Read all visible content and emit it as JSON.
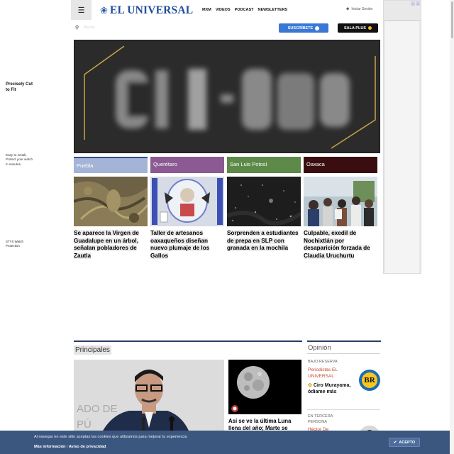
{
  "header": {
    "logo_text": "EL UNIVERSAL",
    "nav": [
      "MXM",
      "VIDEOS",
      "PODCAST",
      "NEWSLETTERS"
    ],
    "login_label": "Iniciar Sesión",
    "search_placeholder": "Buscar",
    "subscribe_label": "SUSCRÍBETE",
    "sala_plus_label": "SALA PLUS"
  },
  "ad": {
    "title": "Precisely Cut to Fit",
    "body": "Easy to install, Protect your watch in minutes.",
    "brand": "STYX Watch Protection"
  },
  "regions": [
    {
      "label": "Puebla",
      "color": "#a4b4d6",
      "title": "Se aparece la Virgen de Guadalupe en un árbol, señalan pobladores de Zautla"
    },
    {
      "label": "Querétaro",
      "color": "#8c5a93",
      "title": "Taller de artesanos oaxaqueños diseñan nuevo plumaje de los Gallos"
    },
    {
      "label": "San Luis Potosí",
      "color": "#5d8a48",
      "title": "Sorprenden a estudiantes de prepa en SLP con granada en la mochila"
    },
    {
      "label": "Oaxaca",
      "color": "#3a0e10",
      "title": "Culpable, exedil de Nochixtlán por desaparición forzada de Claudia Uruchurtu"
    }
  ],
  "principales": {
    "label": "Principales",
    "secondary_title": "Así se ve la última Luna llena del año; Marte se"
  },
  "opinion": {
    "label": "Opinión",
    "items": [
      {
        "section": "BAJO RESERVA",
        "author": "Periodistas EL UNIVERSAL",
        "headline": "Ciro Murayama, ódiame más",
        "logo_text": "BR"
      },
      {
        "section": "EN TERCERA PERSONA",
        "author": "Héctor De"
      }
    ]
  },
  "cookies": {
    "text": "Al navegar en este sitio aceptas las cookies que utilizamos para mejorar tu experiencia",
    "more_info": "Más información",
    "privacy": "Aviso de privacidad",
    "accept": "ACEPTO"
  }
}
